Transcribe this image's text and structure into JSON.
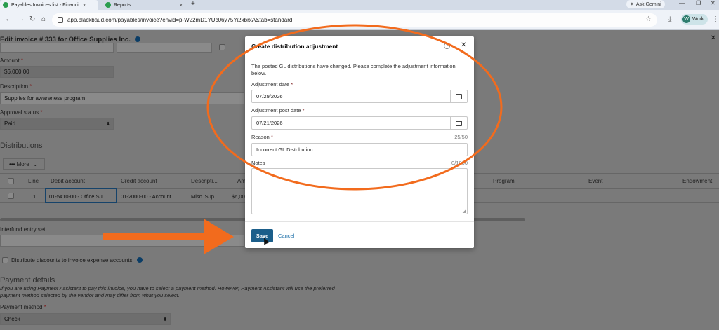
{
  "browser": {
    "tabs": [
      {
        "label": "Payables Invoices list - Financi",
        "active": true
      },
      {
        "label": "Reports",
        "active": false
      }
    ],
    "ask_gemini": "Ask Gemini",
    "url": "app.blackbaud.com/payables/invoice?envid=p-W22mD1YUc06y75Yi2xbrxA&tab=standard",
    "profile_initial": "W",
    "profile_label": "Work"
  },
  "page": {
    "title": "Edit invoice # 333 for Office Supplies Inc.",
    "amount_label": "Amount",
    "amount_value": "$6,000.00",
    "description_label": "Description",
    "description_value": "Supplies for awareness program",
    "approval_label": "Approval status",
    "approval_value": "Paid",
    "distributions_heading": "Distributions",
    "more_button": "••• More",
    "grid_headers": [
      "Line",
      "Debit account",
      "Credit account",
      "Descripti...",
      "Am",
      "Program",
      "Event",
      "Endowment"
    ],
    "grid_row": {
      "line": "1",
      "debit": "01-5410-00 - Office Su...",
      "credit": "01-2000-00 - Account...",
      "description": "Misc. Sup...",
      "amount": "$6,00"
    },
    "interfund_label": "Interfund entry set",
    "distribute_label": "Distribute discounts to invoice expense accounts",
    "payment_heading": "Payment details",
    "payment_note_1": "If you are using Payment Assistant to pay this invoice, you have to select a payment method. However, Payment Assistant will use the preferred",
    "payment_note_2": "payment method selected by the vendor and may differ from what you select.",
    "payment_method_label": "Payment method",
    "payment_method_value": "Check"
  },
  "modal": {
    "title": "Create distribution adjustment",
    "description": "The posted GL distributions have changed. Please complete the adjustment information below.",
    "adjustment_date_label": "Adjustment date",
    "adjustment_date_value": "07/29/2026",
    "adjustment_post_date_label": "Adjustment post date",
    "adjustment_post_date_value": "07/21/2026",
    "reason_label": "Reason",
    "reason_count": "25/50",
    "reason_value": "Incorrect GL Distribution",
    "notes_label": "Notes",
    "notes_count": "0/1000",
    "save_label": "Save",
    "cancel_label": "Cancel",
    "required_mark": "*"
  },
  "colors": {
    "accent": "#1b5e8a",
    "annotation": "#f26b1d",
    "overlay": "#7a7a7a"
  }
}
